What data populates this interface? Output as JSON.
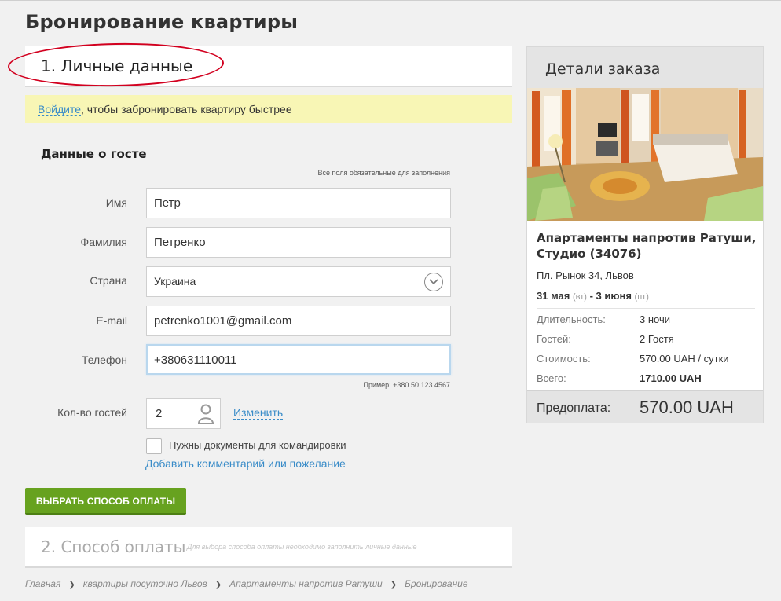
{
  "page": {
    "title": "Бронирование квартиры"
  },
  "section1": {
    "title": "1. Личные данные"
  },
  "login": {
    "link": "Войдите",
    "text": ", чтобы забронировать квартиру быстрее"
  },
  "guest": {
    "heading": "Данные о госте",
    "required_note": "Все поля обязательные для заполнения",
    "fields": [
      {
        "label": "Имя",
        "value": "Петр"
      },
      {
        "label": "Фамилия",
        "value": "Петренко"
      },
      {
        "label": "Страна",
        "value": "Украина"
      },
      {
        "label": "E-mail",
        "value": "petrenko1001@gmail.com"
      },
      {
        "label": "Телефон",
        "value": "+380631110011"
      }
    ],
    "phone_hint": "Пример: +380 50 123 4567",
    "guests_label": "Кол-во гостей",
    "guests_value": "2",
    "change_link": "Изменить",
    "docs_checkbox": "Нужны документы для командировки",
    "add_comment": "Добавить комментарий или пожелание"
  },
  "pay_button": "ВЫБРАТЬ СПОСОБ ОПЛАТЫ",
  "section2": {
    "title": "2. Способ оплаты",
    "note": "Для выбора способа оплаты необходимо заполнить личные данные"
  },
  "breadcrumb": [
    "Главная",
    "квартиры посуточно Львов",
    "Апартаменты напротив Ратуши",
    "Бронирование"
  ],
  "order": {
    "title": "Детали заказа",
    "apartment": "Апартаменты напротив Ратуши, Студио (34076)",
    "address": "Пл. Рынок 34, Львов",
    "date_from": "31 мая",
    "dow_from": "(вт)",
    "dash": "-",
    "date_to": "3 июня",
    "dow_to": "(пт)",
    "details": [
      {
        "label": "Длительность:",
        "value": "3 ночи"
      },
      {
        "label": "Гостей:",
        "value": "2 Гостя"
      },
      {
        "label": "Стоимость:",
        "value": "570.00 UAH / сутки"
      },
      {
        "label": "Всего:",
        "value": "1710.00 UAH"
      }
    ],
    "prepay_label": "Предоплата:",
    "prepay_value": "570.00 UAH"
  },
  "colors": {
    "accent_green": "#67a21f",
    "link_blue": "#3a8cc8",
    "annotation_red": "#d2001f",
    "login_bar": "#f8f6b5"
  }
}
